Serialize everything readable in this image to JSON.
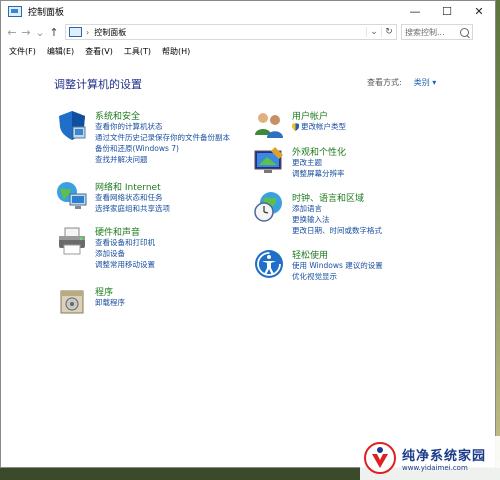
{
  "window": {
    "title": "控制面板"
  },
  "titlebar_buttons": {
    "minimize": "—",
    "maximize": "☐",
    "close": "✕"
  },
  "nav": {
    "back": "←",
    "forward": "→",
    "dropdown": "⌄",
    "up": "↑"
  },
  "address": {
    "separator": "›",
    "text": "控制面板",
    "dropdown": "⌄",
    "refresh": "↻"
  },
  "search": {
    "placeholder": "搜索控制..."
  },
  "menu": [
    "文件(F)",
    "编辑(E)",
    "查看(V)",
    "工具(T)",
    "帮助(H)"
  ],
  "main": {
    "heading": "调整计算机的设置",
    "view_by_label": "查看方式:",
    "view_by_value": "类别 ▾"
  },
  "categories": [
    {
      "title": "系统和安全",
      "icon": "shield-icon",
      "links": [
        "查看你的计算机状态",
        "通过文件历史记录保存你的文件备份副本",
        "备份和还原(Windows 7)",
        "查找并解决问题"
      ]
    },
    {
      "title": "网络和 Internet",
      "icon": "network-globe-icon",
      "links": [
        "查看网络状态和任务",
        "选择家庭组和共享选项"
      ]
    },
    {
      "title": "硬件和声音",
      "icon": "printer-icon",
      "links": [
        "查看设备和打印机",
        "添加设备",
        "调整常用移动设置"
      ]
    },
    {
      "title": "程序",
      "icon": "programs-icon",
      "links": [
        "卸载程序"
      ]
    },
    {
      "title": "用户帐户",
      "icon": "users-icon",
      "links": [
        "更改帐户类型"
      ]
    },
    {
      "title": "外观和个性化",
      "icon": "appearance-icon",
      "links": [
        "更改主题",
        "调整屏幕分辨率"
      ]
    },
    {
      "title": "时钟、语言和区域",
      "icon": "clock-globe-icon",
      "links": [
        "添加语言",
        "更换输入法",
        "更改日期、时间或数字格式"
      ]
    },
    {
      "title": "轻松使用",
      "icon": "ease-of-access-icon",
      "links": [
        "使用 Windows 建议的设置",
        "优化视觉显示"
      ]
    }
  ],
  "watermark": {
    "line1": "纯净系统家园",
    "line2": "www.yidaimei.com"
  },
  "colors": {
    "heading": "#1e3287",
    "category_title": "#1e7a1e",
    "link": "#1a4fa0"
  }
}
